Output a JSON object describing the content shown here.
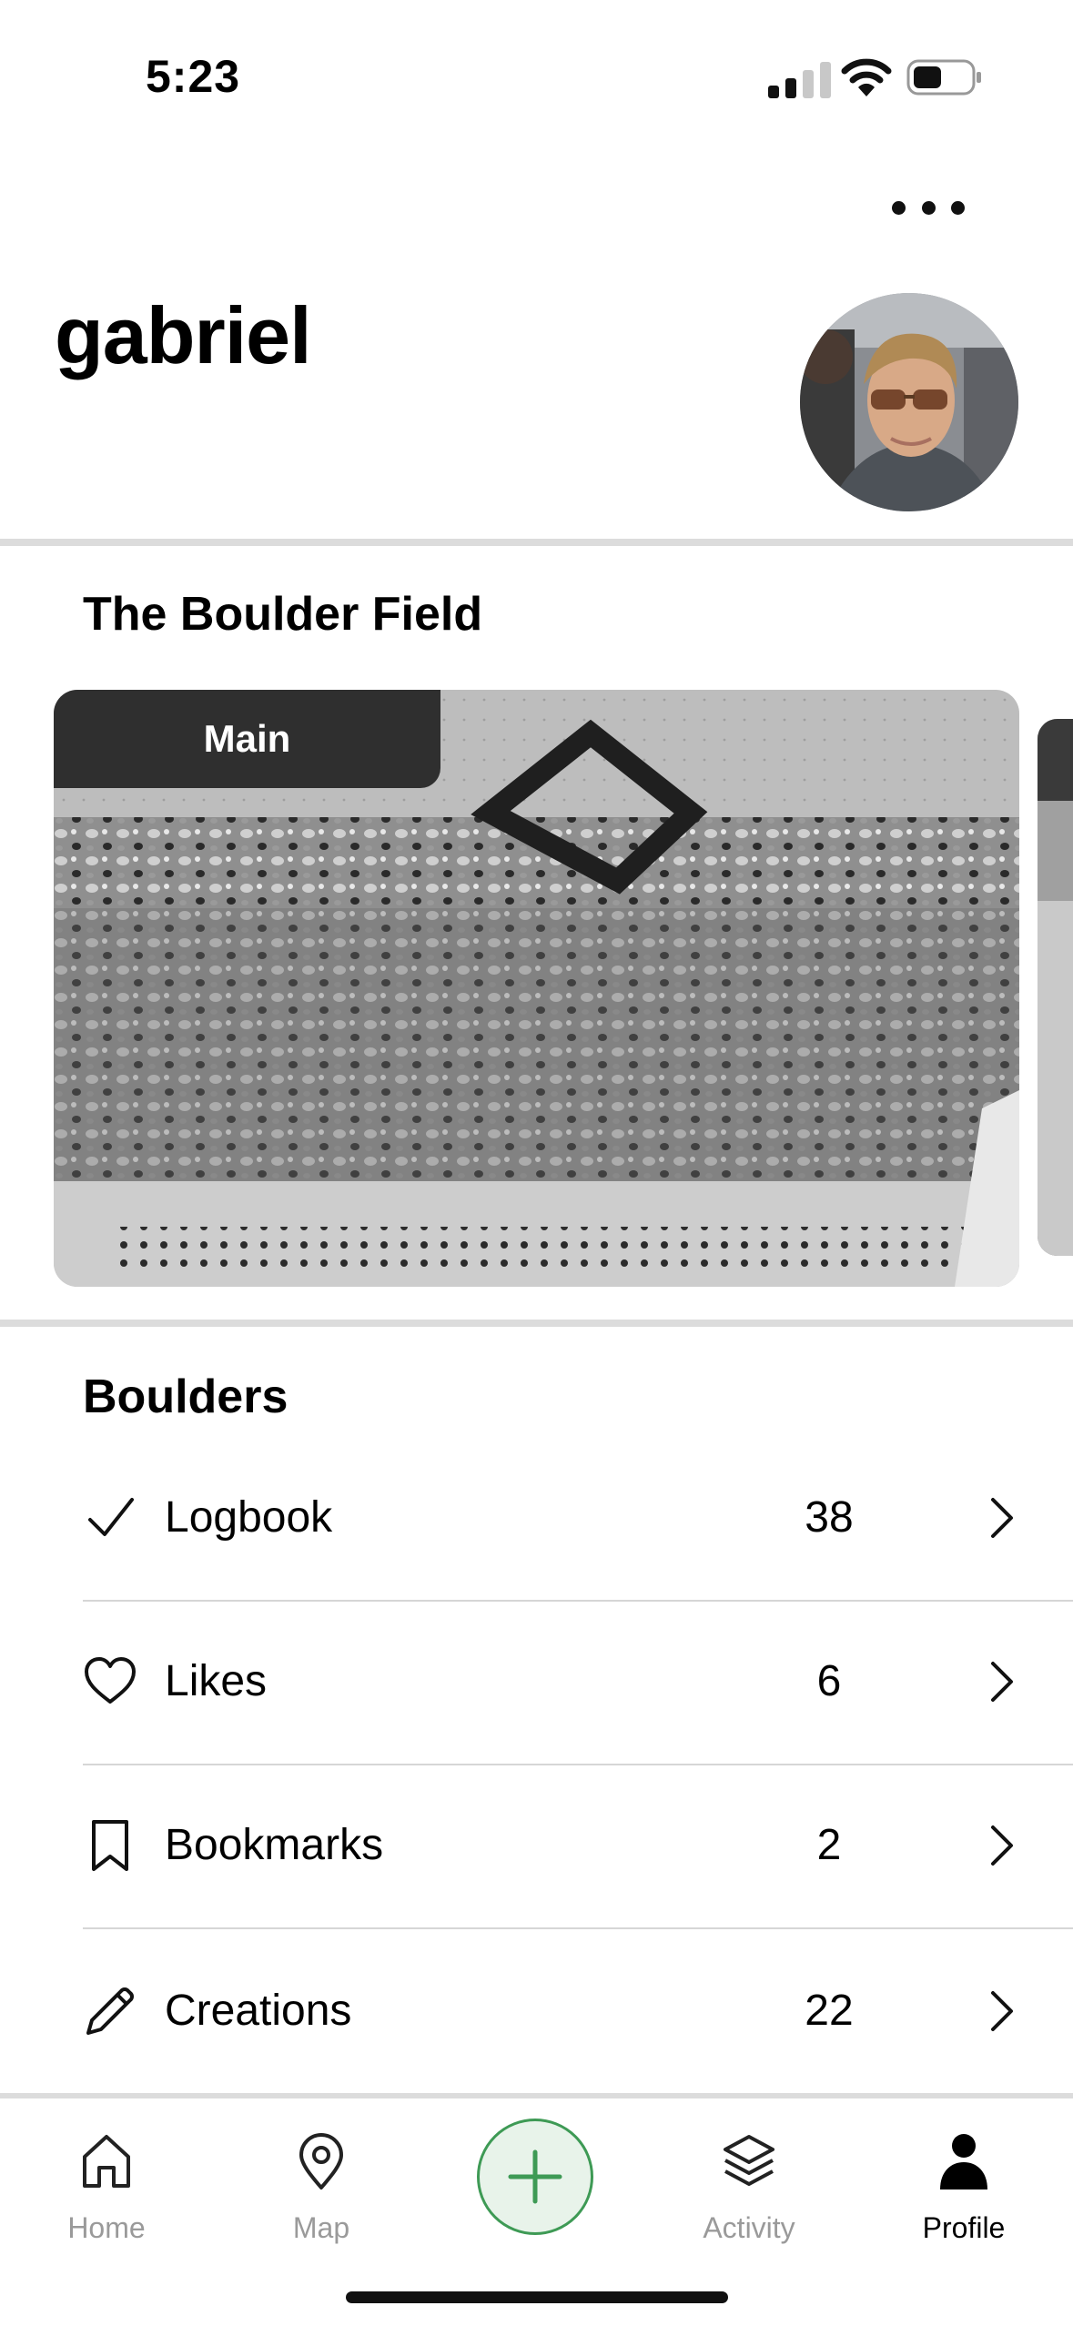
{
  "status_bar": {
    "time": "5:23",
    "icons": [
      "cellular-signal-icon",
      "wifi-icon",
      "battery-icon"
    ]
  },
  "header": {
    "more_icon": "ellipsis-icon",
    "username": "gabriel",
    "avatar": "profile-photo"
  },
  "gym": {
    "name": "The Boulder Field",
    "walls": [
      {
        "label": "Main"
      }
    ]
  },
  "boulders": {
    "title": "Boulders",
    "items": [
      {
        "icon": "checkmark-icon",
        "label": "Logbook",
        "count": "38"
      },
      {
        "icon": "heart-icon",
        "label": "Likes",
        "count": "6"
      },
      {
        "icon": "bookmark-icon",
        "label": "Bookmarks",
        "count": "2"
      },
      {
        "icon": "pencil-icon",
        "label": "Creations",
        "count": "22"
      }
    ]
  },
  "tab_bar": {
    "tabs": [
      {
        "label": "Home",
        "icon": "home-icon",
        "active": false
      },
      {
        "label": "Map",
        "icon": "map-pin-icon",
        "active": false
      },
      {
        "label": "Activity",
        "icon": "layers-icon",
        "active": false
      },
      {
        "label": "Profile",
        "icon": "person-icon",
        "active": true
      }
    ],
    "add_icon": "plus-icon"
  },
  "colors": {
    "accent_green": "#3e9a55",
    "add_button_fill": "#e8f3ea",
    "divider": "#dcdcdc",
    "inactive_tab": "#9a9a9a"
  }
}
